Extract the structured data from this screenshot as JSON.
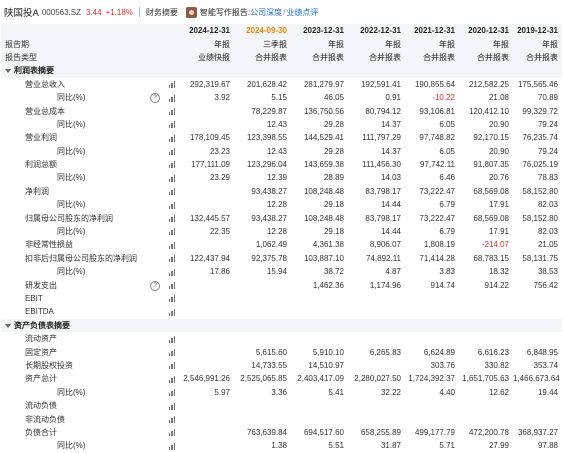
{
  "header": {
    "stock_name": "陕国投A",
    "stock_code": "000563.SZ",
    "price": "3.44",
    "change_pct": "+1.18%",
    "fin_summary": "财务摘要",
    "ai_label": "智能写作报告:",
    "link_company": "公司深度",
    "link_separator": "/",
    "link_review": "业绩点评"
  },
  "columns": [
    {
      "date": "2024-12-31",
      "period": "年报",
      "type": "业绩快报",
      "highlight": false
    },
    {
      "date": "2024-09-30",
      "period": "三季报",
      "type": "合并报表",
      "highlight": true
    },
    {
      "date": "2023-12-31",
      "period": "年报",
      "type": "合并报表",
      "highlight": false
    },
    {
      "date": "2022-12-31",
      "period": "年报",
      "type": "合并报表",
      "highlight": false
    },
    {
      "date": "2021-12-31",
      "period": "年报",
      "type": "合并报表",
      "highlight": false
    },
    {
      "date": "2020-12-31",
      "period": "年报",
      "type": "合并报表",
      "highlight": false
    },
    {
      "date": "2019-12-31",
      "period": "年报",
      "type": "合并报表",
      "highlight": false
    }
  ],
  "head_labels": {
    "period_label": "报告期",
    "type_label": "报告类型"
  },
  "sections": [
    {
      "name": "利润表摘要"
    },
    {
      "name": "资产负债表摘要"
    }
  ],
  "rows": [
    {
      "kind": "section",
      "section": 0
    },
    {
      "label": "营业总收入",
      "indent": 1,
      "chart": true,
      "values": [
        "292,319.67",
        "201,628.42",
        "281,279.97",
        "192,591.41",
        "190,855.64",
        "212,582.25",
        "175,565.46"
      ]
    },
    {
      "label": "同比(%)",
      "indent": 2,
      "info": true,
      "chart": true,
      "values": [
        "3.92",
        "5.15",
        "46.05",
        "0.91",
        "-10.22",
        "21.08",
        "70.89"
      ]
    },
    {
      "label": "营业总成本",
      "indent": 1,
      "chart": true,
      "values": [
        "",
        "78,229.87",
        "136,750.56",
        "80,794.12",
        "93,106.81",
        "120,412.10",
        "99,329.72"
      ]
    },
    {
      "label": "同比(%)",
      "indent": 2,
      "chart": true,
      "values": [
        "",
        "12.43",
        "29.28",
        "14.37",
        "6.05",
        "20.90",
        "79.24"
      ]
    },
    {
      "label": "营业利润",
      "indent": 1,
      "chart": true,
      "values": [
        "178,109.45",
        "123,398.55",
        "144,529.41",
        "111,797.29",
        "97,748.82",
        "92,170.15",
        "76,235.74"
      ]
    },
    {
      "label": "同比(%)",
      "indent": 2,
      "chart": true,
      "values": [
        "23.23",
        "12.43",
        "29.28",
        "14.37",
        "6.05",
        "20.90",
        "79.24"
      ]
    },
    {
      "label": "利润总额",
      "indent": 1,
      "chart": true,
      "values": [
        "177,111.09",
        "123,296.04",
        "143,659.38",
        "111,456.30",
        "97,742.11",
        "91,807.35",
        "76,025.19"
      ]
    },
    {
      "label": "同比(%)",
      "indent": 2,
      "chart": true,
      "values": [
        "23.29",
        "12.39",
        "28.89",
        "14.03",
        "6.46",
        "20.76",
        "78.83"
      ]
    },
    {
      "label": "净利润",
      "indent": 1,
      "chart": true,
      "values": [
        "",
        "93,438.27",
        "108,248.48",
        "83,798.17",
        "73,222.47",
        "68,569.08",
        "58,152.80"
      ]
    },
    {
      "label": "同比(%)",
      "indent": 2,
      "chart": true,
      "values": [
        "",
        "12.28",
        "29.18",
        "14.44",
        "6.79",
        "17.91",
        "82.03"
      ]
    },
    {
      "label": "归属母公司股东的净利润",
      "indent": 1,
      "chart": true,
      "values": [
        "132,445.57",
        "93,438.27",
        "108,248.48",
        "83,798.17",
        "73,222.47",
        "68,569.08",
        "58,152.80"
      ]
    },
    {
      "label": "同比(%)",
      "indent": 2,
      "chart": true,
      "values": [
        "22.35",
        "12.28",
        "29.18",
        "14.44",
        "6.79",
        "17.91",
        "82.03"
      ]
    },
    {
      "label": "非经常性损益",
      "indent": 1,
      "chart": true,
      "values": [
        "",
        "1,062.49",
        "4,361.38",
        "8,906.07",
        "1,808.19",
        "-214.07",
        "21.05"
      ]
    },
    {
      "label": "扣非后归属母公司股东的净利润",
      "indent": 1,
      "chart": true,
      "values": [
        "122,437.94",
        "92,375.78",
        "103,887.10",
        "74,892.11",
        "71,414.28",
        "68,783.15",
        "58,131.75"
      ]
    },
    {
      "label": "同比(%)",
      "indent": 2,
      "chart": true,
      "values": [
        "17.86",
        "15.94",
        "38.72",
        "4.87",
        "3.83",
        "18.32",
        "38.53"
      ]
    },
    {
      "label": "研发支出",
      "indent": 1,
      "info": true,
      "chart": true,
      "values": [
        "",
        "",
        "1,462.36",
        "1,174.96",
        "914.74",
        "914.22",
        "756.42"
      ]
    },
    {
      "label": "EBIT",
      "indent": 1,
      "chart": true,
      "values": [
        "",
        "",
        "",
        "",
        "",
        "",
        ""
      ]
    },
    {
      "label": "EBITDA",
      "indent": 1,
      "chart": true,
      "values": [
        "",
        "",
        "",
        "",
        "",
        "",
        ""
      ]
    },
    {
      "kind": "section",
      "section": 1
    },
    {
      "label": "流动资产",
      "indent": 1,
      "chart": true,
      "values": [
        "",
        "",
        "",
        "",
        "",
        "",
        ""
      ]
    },
    {
      "label": "固定资产",
      "indent": 1,
      "chart": true,
      "values": [
        "",
        "5,615.60",
        "5,910.10",
        "6,265.83",
        "6,624.89",
        "6,616.23",
        "6,848.95"
      ]
    },
    {
      "label": "长期股权投资",
      "indent": 1,
      "chart": true,
      "values": [
        "",
        "14,733.55",
        "14,510.97",
        "",
        "303.76",
        "330.82",
        "353.74"
      ]
    },
    {
      "label": "资产总计",
      "indent": 1,
      "chart": true,
      "values": [
        "2,546,991.26",
        "2,525,065.85",
        "2,403,417.09",
        "2,280,027.50",
        "1,724,392.37",
        "1,651,705.63",
        "1,466,673.64"
      ]
    },
    {
      "label": "同比(%)",
      "indent": 2,
      "chart": true,
      "values": [
        "5.97",
        "3.36",
        "5.41",
        "32.22",
        "4.40",
        "12.62",
        "19.44"
      ]
    },
    {
      "label": "流动负债",
      "indent": 1,
      "chart": true,
      "values": [
        "",
        "",
        "",
        "",
        "",
        "",
        ""
      ]
    },
    {
      "label": "非流动负债",
      "indent": 1,
      "chart": true,
      "values": [
        "",
        "",
        "",
        "",
        "",
        "",
        ""
      ]
    },
    {
      "label": "负债合计",
      "indent": 1,
      "chart": true,
      "values": [
        "",
        "763,639.84",
        "694,517.60",
        "658,255.89",
        "499,177.79",
        "472,200.78",
        "368,937.27"
      ]
    },
    {
      "label": "同比(%)",
      "indent": 2,
      "chart": true,
      "values": [
        "",
        "1.38",
        "5.51",
        "31.87",
        "5.71",
        "27.99",
        "97.88"
      ]
    }
  ]
}
